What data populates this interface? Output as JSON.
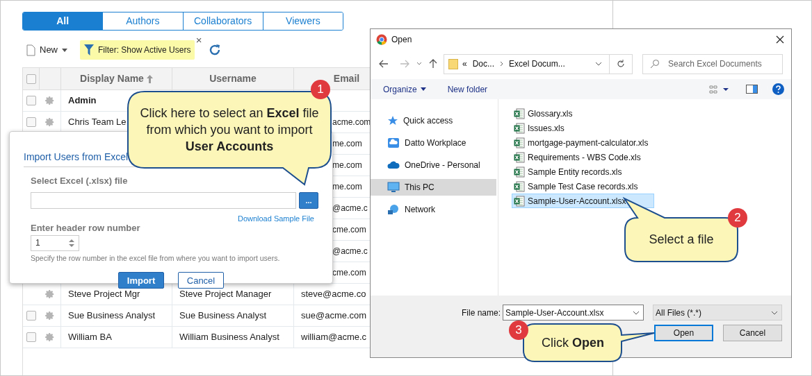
{
  "tabs": [
    {
      "label": "All",
      "selected": true
    },
    {
      "label": "Authors",
      "selected": false
    },
    {
      "label": "Collaborators",
      "selected": false
    },
    {
      "label": "Viewers",
      "selected": false
    }
  ],
  "toolbar": {
    "new_button": "New",
    "filter": "Filter: Show Active Users",
    "filter_close": "×"
  },
  "table": {
    "header_checked": false,
    "columns": [
      {
        "label": "Display Name",
        "sorted": true
      },
      {
        "label": "Username",
        "sorted": false
      },
      {
        "label": "Email",
        "sorted": false
      }
    ],
    "rows": [
      {
        "checked": false,
        "display_name": "Admin",
        "bold": true
      },
      {
        "checked": false,
        "display_name": "Chris Team Le",
        "email": "acme.com",
        "bold": false
      },
      {
        "email": "me.com"
      },
      {
        "email": "me.com"
      },
      {
        "email": "me.com"
      },
      {
        "email": "@acme.c"
      },
      {
        "email": "cme.com"
      },
      {
        "email": "@acme.c"
      },
      {
        "email": "cme.com"
      },
      {
        "display_name": "Steve Project Mgr",
        "username": "Steve Project Manager",
        "email": "steve@acme.co",
        "bold": false
      },
      {
        "checked": false,
        "display_name": "Sue Business Analyst",
        "username": "Sue Business Analyst",
        "email": "sue@acme.com",
        "bold": false
      },
      {
        "checked": false,
        "display_name": "William BA",
        "username": "William Business Analyst",
        "email": "william@acme.c",
        "bold": false
      }
    ]
  },
  "import_dialog": {
    "title": "Import Users from Excel",
    "file_label": "Select Excel (.xlsx) file",
    "browse_button": "...",
    "download_link": "Download Sample File",
    "header_label": "Enter header row number",
    "header_value": "1",
    "hint": "Specify the row number in the excel file from where you want to import users.",
    "import_button": "Import",
    "cancel_button": "Cancel"
  },
  "open_dialog": {
    "title": "Open",
    "path_prefix": "«",
    "path": [
      "Doc...",
      "Excel Docum..."
    ],
    "search_placeholder": "Search Excel Documents",
    "organize": "Organize",
    "new_folder": "New folder",
    "nav": [
      {
        "label": "Quick access",
        "selected": false
      },
      {
        "label": "Datto Workplace",
        "selected": false
      },
      {
        "label": "OneDrive - Personal",
        "selected": false
      },
      {
        "label": "This PC",
        "selected": true
      },
      {
        "label": "Network",
        "selected": false
      }
    ],
    "files": [
      {
        "name": "Glossary.xls",
        "selected": false
      },
      {
        "name": "Issues.xls",
        "selected": false
      },
      {
        "name": "mortgage-payment-calculator.xls",
        "selected": false
      },
      {
        "name": "Requirements - WBS Code.xls",
        "selected": false
      },
      {
        "name": "Sample Entity records.xls",
        "selected": false
      },
      {
        "name": "Sample Test Case records.xls",
        "selected": false
      },
      {
        "name": "Sample-User-Account.xlsx",
        "selected": true
      }
    ],
    "file_name_label": "File name:",
    "file_name_value": "Sample-User-Account.xlsx",
    "file_type": "All Files (*.*)",
    "open_button": "Open",
    "cancel_button": "Cancel"
  },
  "callouts": [
    {
      "number": "1",
      "text": "Click here to select an **Excel** file from which you want to import **User Accounts**"
    },
    {
      "number": "2",
      "text": "Select a file"
    },
    {
      "number": "3",
      "text": "Click **Open**"
    }
  ]
}
